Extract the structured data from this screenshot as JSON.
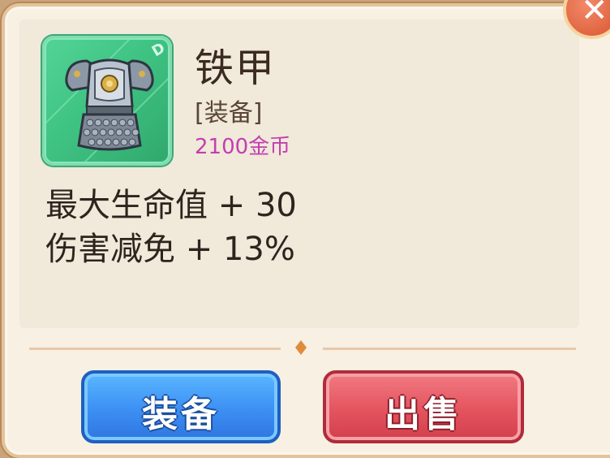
{
  "item": {
    "name": "铁甲",
    "type": "[装备]",
    "price": "2100金币",
    "rank": "D",
    "icon": "iron-armor-icon"
  },
  "stats": [
    "最大生命值 + 30",
    "伤害减免 + 13%"
  ],
  "buttons": {
    "equip_label": "装备",
    "sell_label": "出售"
  },
  "colors": {
    "price": "#c23fb2",
    "equip_button": "#3c8ff3",
    "sell_button": "#e4545f",
    "item_frame": "#3fc383"
  }
}
